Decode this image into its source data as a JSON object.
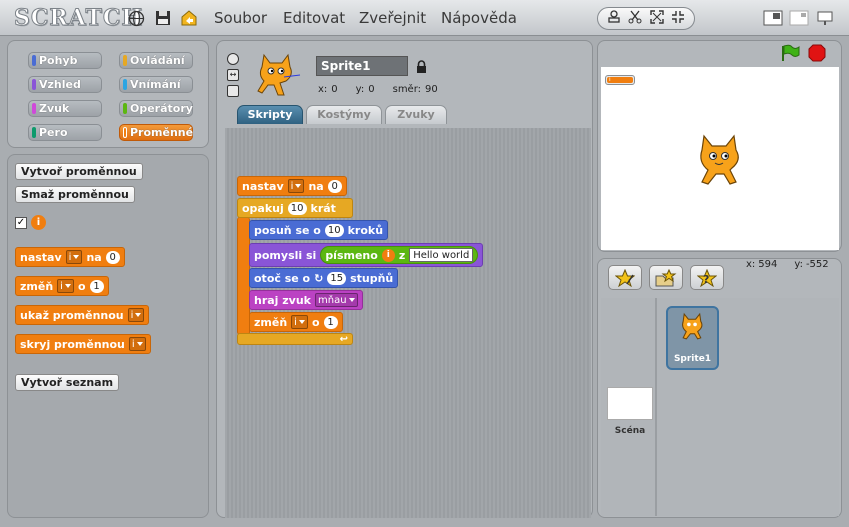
{
  "app": {
    "logo": "SCRATCH"
  },
  "menu": [
    "Soubor",
    "Editovat",
    "Zveřejnit",
    "Nápověda"
  ],
  "categories": [
    {
      "label": "Pohyb",
      "color": "#4a6cd4"
    },
    {
      "label": "Ovládání",
      "color": "#e6a823"
    },
    {
      "label": "Vzhled",
      "color": "#8a55d7"
    },
    {
      "label": "Vnímání",
      "color": "#2ca5e2"
    },
    {
      "label": "Zvuk",
      "color": "#cf4ad9"
    },
    {
      "label": "Operátory",
      "color": "#5cb712"
    },
    {
      "label": "Pero",
      "color": "#0e9a6c"
    },
    {
      "label": "Proměnné",
      "color": "#f07e10"
    }
  ],
  "palette": {
    "make_variable": "Vytvoř proměnnou",
    "delete_variable": "Smaž proměnnou",
    "variable_name": "i",
    "set_label": "nastav",
    "set_to": "na",
    "set_value": "0",
    "change_label": "změň",
    "change_by": "o",
    "change_value": "1",
    "show_label": "ukaž proměnnou",
    "hide_label": "skryj proměnnou",
    "make_list": "Vytvoř seznam"
  },
  "sprite": {
    "name": "Sprite1",
    "x_label": "x:",
    "x": "0",
    "y_label": "y:",
    "y": "0",
    "dir_label": "směr:",
    "dir": "90"
  },
  "tabs": [
    "Skripty",
    "Kostýmy",
    "Zvuky"
  ],
  "script": {
    "set": "nastav",
    "var": "i",
    "to": "na",
    "set_val": "0",
    "repeat": "opakuj",
    "repeat_n": "10",
    "times": "krát",
    "move": "posuň se o",
    "move_n": "10",
    "steps": "kroků",
    "think": "pomysli si",
    "letter": "písmeno",
    "letter_var": "i",
    "of": "z",
    "word": "Hello world",
    "turn": "otoč se o",
    "turn_n": "15",
    "degrees": "stupňů",
    "play": "hraj zvuk",
    "sound": "mňau",
    "change": "změň",
    "change_var": "i",
    "by": "o",
    "change_val": "1"
  },
  "stage": {
    "monitor": "i",
    "mouse_x_label": "x:",
    "mouse_x": "594",
    "mouse_y_label": "y:",
    "mouse_y": "-552"
  },
  "sprites": [
    {
      "name": "Sprite1"
    }
  ],
  "scene": "Scéna"
}
